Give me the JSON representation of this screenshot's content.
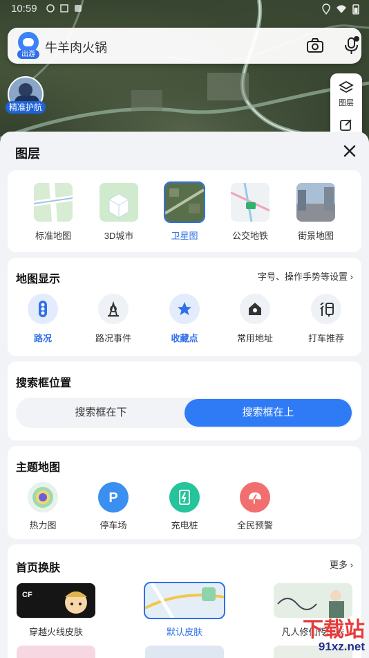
{
  "status": {
    "time": "10:59"
  },
  "search": {
    "logo_tag": "出游",
    "query": "牛羊肉火锅"
  },
  "guard": {
    "label": "精准护航"
  },
  "map_tools": {
    "layers_label": "图层"
  },
  "sheet": {
    "title": "图层",
    "layers": [
      {
        "label": "标准地图",
        "icon": "standard-map-thumb",
        "selected": false
      },
      {
        "label": "3D城市",
        "icon": "3d-city-thumb",
        "selected": false
      },
      {
        "label": "卫星图",
        "icon": "satellite-thumb",
        "selected": true
      },
      {
        "label": "公交地铁",
        "icon": "transit-thumb",
        "selected": false
      },
      {
        "label": "街景地图",
        "icon": "street-view-thumb",
        "selected": false
      }
    ],
    "display": {
      "title": "地图显示",
      "link": "字号、操作手势等设置",
      "items": [
        {
          "label": "路况",
          "icon": "traffic-light-icon",
          "on": true
        },
        {
          "label": "路况事件",
          "icon": "traffic-event-icon",
          "on": false
        },
        {
          "label": "收藏点",
          "icon": "star-icon",
          "on": true
        },
        {
          "label": "常用地址",
          "icon": "home-icon",
          "on": false
        },
        {
          "label": "打车推荐",
          "icon": "taxi-icon",
          "on": false
        }
      ]
    },
    "search_position": {
      "title": "搜索框位置",
      "options": [
        {
          "label": "搜索框在下",
          "active": false
        },
        {
          "label": "搜索框在上",
          "active": true
        }
      ]
    },
    "theme": {
      "title": "主题地图",
      "items": [
        {
          "label": "热力图",
          "icon": "heatmap-icon"
        },
        {
          "label": "停车场",
          "icon": "parking-icon"
        },
        {
          "label": "充电桩",
          "icon": "charging-icon"
        },
        {
          "label": "全民预警",
          "icon": "alert-icon"
        }
      ]
    },
    "skin": {
      "title": "首页换肤",
      "more": "更多",
      "items": [
        {
          "label": "穿越火线皮肤",
          "selected": false
        },
        {
          "label": "默认皮肤",
          "selected": true
        },
        {
          "label": "凡人修仙传皮肤",
          "selected": false
        }
      ]
    }
  },
  "watermark": {
    "text": "下载站",
    "url": "91xz.net"
  },
  "colors": {
    "accent": "#2f6fe8",
    "sheet_bg": "#f1f3f6"
  }
}
